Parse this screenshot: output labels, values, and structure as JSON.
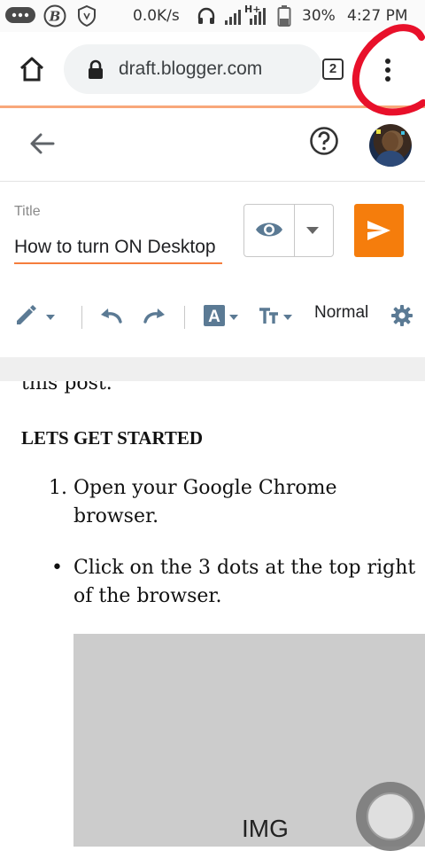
{
  "status_bar": {
    "network_speed": "0.0K/s",
    "network_type": "H+",
    "battery": "30%",
    "time": "4:27 PM",
    "icons": [
      "chat-bubble-icon",
      "b-badge-icon",
      "shield-icon",
      "headphones-icon",
      "signal-icon",
      "battery-icon"
    ]
  },
  "browser": {
    "url": "draft.blogger.com",
    "tab_count": "2",
    "icons": [
      "home-icon",
      "lock-icon",
      "tab-switcher-icon",
      "more-menu-icon"
    ]
  },
  "editor_header": {
    "icons": [
      "back-arrow-icon",
      "help-icon",
      "avatar"
    ]
  },
  "post": {
    "title_label": "Title",
    "title_value": "How to turn ON Desktop"
  },
  "toolbar": {
    "paragraph_style": "Normal",
    "icons": [
      "pencil-icon",
      "undo-icon",
      "redo-icon",
      "text-color-icon",
      "font-size-icon",
      "settings-gear-icon"
    ]
  },
  "content": {
    "cut_text": "this post.",
    "heading": "LETS GET STARTED",
    "ordered_item_number": "1.",
    "ordered_item": "Open your Google Chrome browser.",
    "bullet_marker": "•",
    "bullet_item": "Click on the 3 dots at the top right of the browser.",
    "image_label": "IMG"
  },
  "colors": {
    "accent_orange": "#f57d0c",
    "underline_orange": "#f57d3d",
    "icon_gray": "#5f6368",
    "icon_blue_gray": "#5b7a94",
    "annotation_red": "#e8102a"
  }
}
